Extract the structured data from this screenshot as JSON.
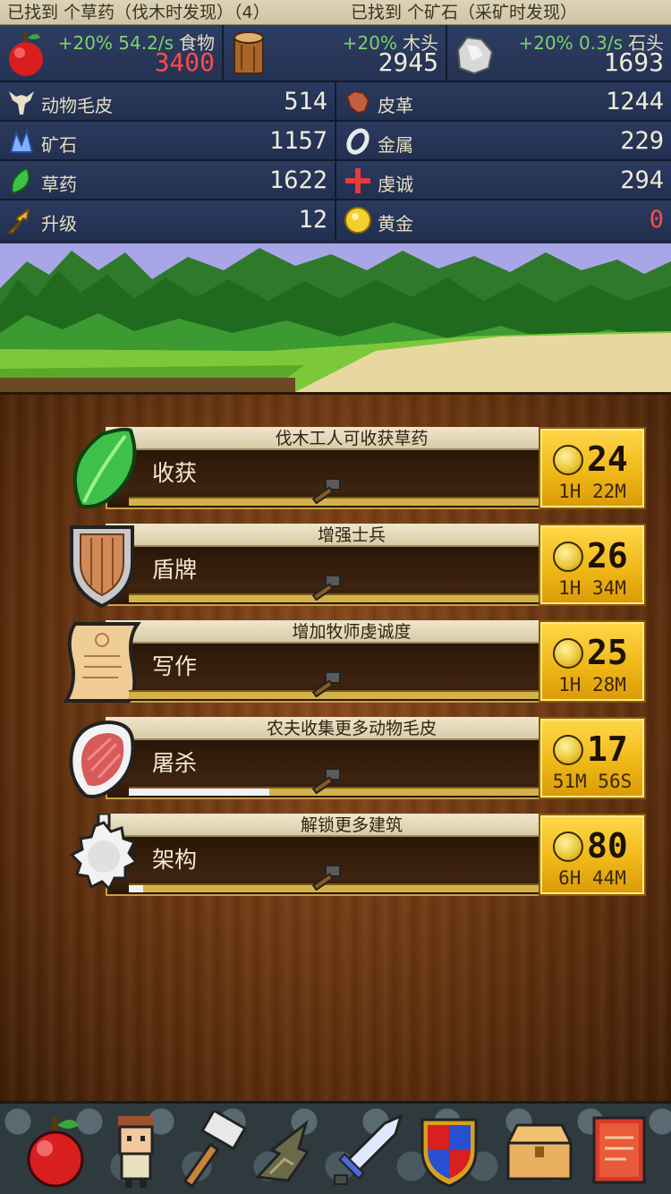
{
  "notifications": {
    "left": "已找到 个草药（伐木时发现）（4）",
    "right": "已找到 个矿石（采矿时发现）"
  },
  "top_resources": [
    {
      "icon": "apple-icon",
      "rate": "+20% 54.2/s",
      "name": "食物",
      "amount": "3400",
      "amount_color": "red"
    },
    {
      "icon": "log-icon",
      "rate": "+20%",
      "name": "木头",
      "amount": "2945",
      "amount_color": "normal"
    },
    {
      "icon": "stone-icon",
      "rate": "+20% 0.3/s",
      "name": "石头",
      "amount": "1693",
      "amount_color": "normal"
    }
  ],
  "resources": {
    "fur": {
      "label": "动物毛皮",
      "value": "514"
    },
    "leather": {
      "label": "皮革",
      "value": "1244"
    },
    "ore": {
      "label": "矿石",
      "value": "1157"
    },
    "metal": {
      "label": "金属",
      "value": "229"
    },
    "herbs": {
      "label": "草药",
      "value": "1622"
    },
    "piety": {
      "label": "虔诚",
      "value": "294"
    },
    "upgrade": {
      "label": "升级",
      "value": "12"
    },
    "gold": {
      "label": "黄金",
      "value": "0"
    }
  },
  "tasks": [
    {
      "desc": "伐木工人可收获草药",
      "name": "收获",
      "cost": "24",
      "time": "1H 22M",
      "progress": 0.0,
      "icon": "leaf-icon"
    },
    {
      "desc": "增强士兵",
      "name": "盾牌",
      "cost": "26",
      "time": "1H 34M",
      "progress": 0.0,
      "icon": "shield-icon"
    },
    {
      "desc": "增加牧师虔诚度",
      "name": "写作",
      "cost": "25",
      "time": "1H 28M",
      "progress": 0.0,
      "icon": "scroll-icon"
    },
    {
      "desc": "农夫收集更多动物毛皮",
      "name": "屠杀",
      "cost": "17",
      "time": "51M 56S",
      "progress": 0.3,
      "icon": "meat-icon"
    },
    {
      "desc": "解锁更多建筑",
      "name": "架构",
      "cost": "80",
      "time": "6H 44M",
      "progress": 0.03,
      "icon": "gear-icon"
    }
  ],
  "nav": [
    "apple-icon",
    "villager-icon",
    "hammer-icon",
    "map-icon",
    "sword-icon",
    "shield-icon",
    "chest-icon",
    "book-icon"
  ],
  "colors": {
    "positive_rate": "#7fd36a",
    "warning": "#ff4a4a",
    "gold_button": "#f0b818",
    "panel": "#2a3a5e"
  }
}
